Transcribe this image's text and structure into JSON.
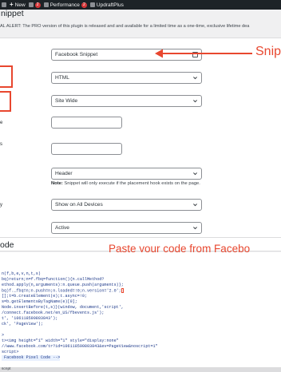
{
  "adminbar": {
    "items": [
      {
        "label": "",
        "icon": "wordpress-icon"
      },
      {
        "label": "New",
        "icon": "plus-icon"
      },
      {
        "badge": "2",
        "icon": "updates-icon"
      },
      {
        "label": "Performance",
        "badge": "2",
        "icon": "performance-icon"
      },
      {
        "label": "UpdraftPlus",
        "icon": "updraft-icon"
      }
    ]
  },
  "page": {
    "title": "nippet",
    "alert": "AL ALERT: The PRO version of this plugin is released and and available for a limited time as a one-time, exclusive lifetime dea"
  },
  "form": {
    "snippet_title": "Facebook Snippet",
    "code_type": "HTML",
    "site_display": "Site Wide",
    "row_labels": [
      "e",
      "s",
      "",
      "y"
    ],
    "placement": "Header",
    "note_bold": "Note:",
    "note_text": " Snippet will only execute if the placement hook exists on the page.",
    "device": "Show on All Devices",
    "status": "Active"
  },
  "annotations": {
    "top": "Snipp",
    "code": "Paste your code from Facebo"
  },
  "code_section": {
    "title": "ode",
    "lines": [
      "n(f,b,e,v,n,t,s)",
      "bq)return;n=f.fbq=function(){n.callMethod?",
      "ethod.apply(n,arguments):n.queue.push(arguments)};",
      "bq)f._fbq=n;n.push=n;n.loaded=!0;n.version='2.0';",
      "[];t=b.createElement(e);t.async=!0;",
      "s=b.getElementsByTagName(e)[0];",
      "Node.insertBefore(t,s)}(window, document,'script',",
      "/connect.facebook.net/en_US/fbevents.js');",
      "t', '106118590803843');",
      "ck', 'PageView');",
      "",
      ">",
      "t><img height=\"1\" width=\"1\" style=\"display:none\"",
      "//www.facebook.com/tr?id=106118590803843&ev=PageView&noscript=1\"",
      "script>",
      " Facebook Pixel Code -->"
    ]
  },
  "footer": {
    "text": "script"
  },
  "colors": {
    "accent": "#e8472f",
    "adminbar": "#1d2327",
    "badge": "#d63638"
  }
}
